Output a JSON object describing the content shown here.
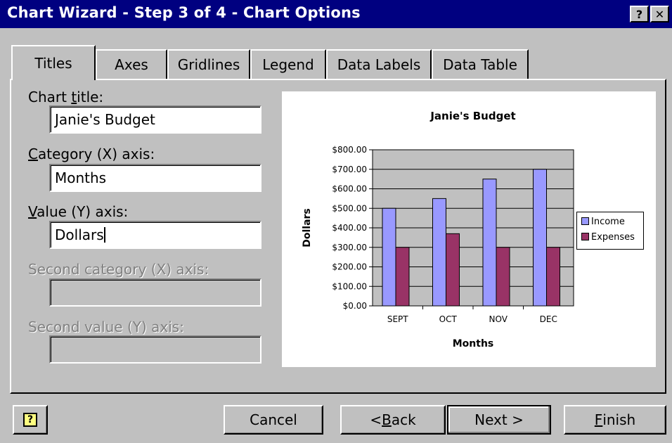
{
  "window": {
    "title": "Chart Wizard - Step 3 of 4 - Chart Options",
    "help_label": "?",
    "close_label": "✕"
  },
  "tabs": [
    {
      "label": "Titles",
      "active": true
    },
    {
      "label": "Axes"
    },
    {
      "label": "Gridlines"
    },
    {
      "label": "Legend"
    },
    {
      "label": "Data Labels"
    },
    {
      "label": "Data Table"
    }
  ],
  "fields": {
    "chart_title": {
      "label_pre": "Chart ",
      "label_ul": "t",
      "label_post": "itle:",
      "value": "Janie's Budget"
    },
    "category_x": {
      "label_pre": "",
      "label_ul": "C",
      "label_post": "ategory (X) axis:",
      "value": "Months"
    },
    "value_y": {
      "label_pre": "",
      "label_ul": "V",
      "label_post": "alue (Y) axis:",
      "value": "Dollars"
    },
    "second_category_x": {
      "label": "Second category (X) axis:",
      "value": "",
      "disabled": true
    },
    "second_value_y": {
      "label": "Second value (Y) axis:",
      "value": "",
      "disabled": true
    }
  },
  "chart_data": {
    "type": "bar",
    "title": "Janie's Budget",
    "xlabel": "Months",
    "ylabel": "Dollars",
    "categories": [
      "SEPT",
      "OCT",
      "NOV",
      "DEC"
    ],
    "series": [
      {
        "name": "Income",
        "values": [
          500,
          550,
          650,
          700
        ],
        "color": "#9999ff"
      },
      {
        "name": "Expenses",
        "values": [
          300,
          370,
          300,
          300
        ],
        "color": "#993366"
      }
    ],
    "ylim": [
      0,
      800
    ],
    "yticks": [
      "$0.00",
      "$100.00",
      "$200.00",
      "$300.00",
      "$400.00",
      "$500.00",
      "$600.00",
      "$700.00",
      "$800.00"
    ],
    "plot_background": "#c0c0c0",
    "grid": true,
    "legend_position": "right"
  },
  "buttons": {
    "cancel": "Cancel",
    "back_pre": "< ",
    "back_ul": "B",
    "back_post": "ack",
    "next": "Next >",
    "finish_ul": "F",
    "finish_post": "inish"
  },
  "icons": {
    "office_assistant": "office-assistant-icon"
  }
}
